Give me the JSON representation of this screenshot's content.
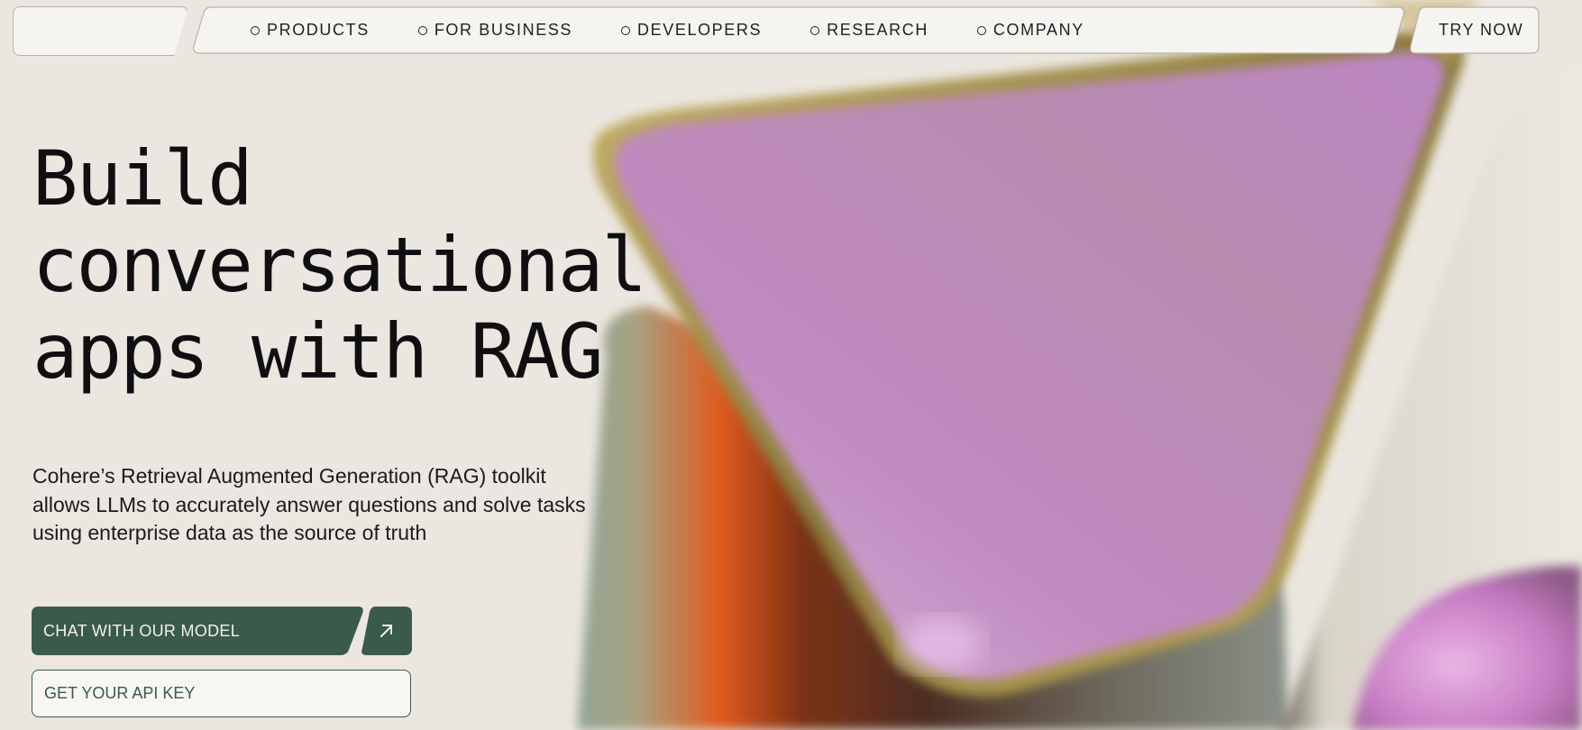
{
  "nav": {
    "items": [
      {
        "label": "PRODUCTS"
      },
      {
        "label": "FOR BUSINESS"
      },
      {
        "label": "DEVELOPERS"
      },
      {
        "label": "RESEARCH"
      },
      {
        "label": "COMPANY"
      }
    ],
    "cta_label": "TRY NOW"
  },
  "hero": {
    "headline_lines": [
      "Build",
      "conversational",
      "apps with RAG"
    ],
    "description": "Cohere’s Retrieval Augmented Generation (RAG) toolkit allows LLMs to accurately answer questions and solve tasks using enterprise data as the source of truth",
    "primary_button_label": "CHAT WITH OUR MODEL",
    "primary_button_icon": "arrow-up-right-icon",
    "secondary_button_label": "GET YOUR API KEY"
  },
  "colors": {
    "background": "#ebe7e0",
    "accent_green": "#3a5a4b",
    "surface": "#f6f4f0",
    "purple_shape": "#bf8ac0",
    "orange_glow": "#e55a1c"
  }
}
